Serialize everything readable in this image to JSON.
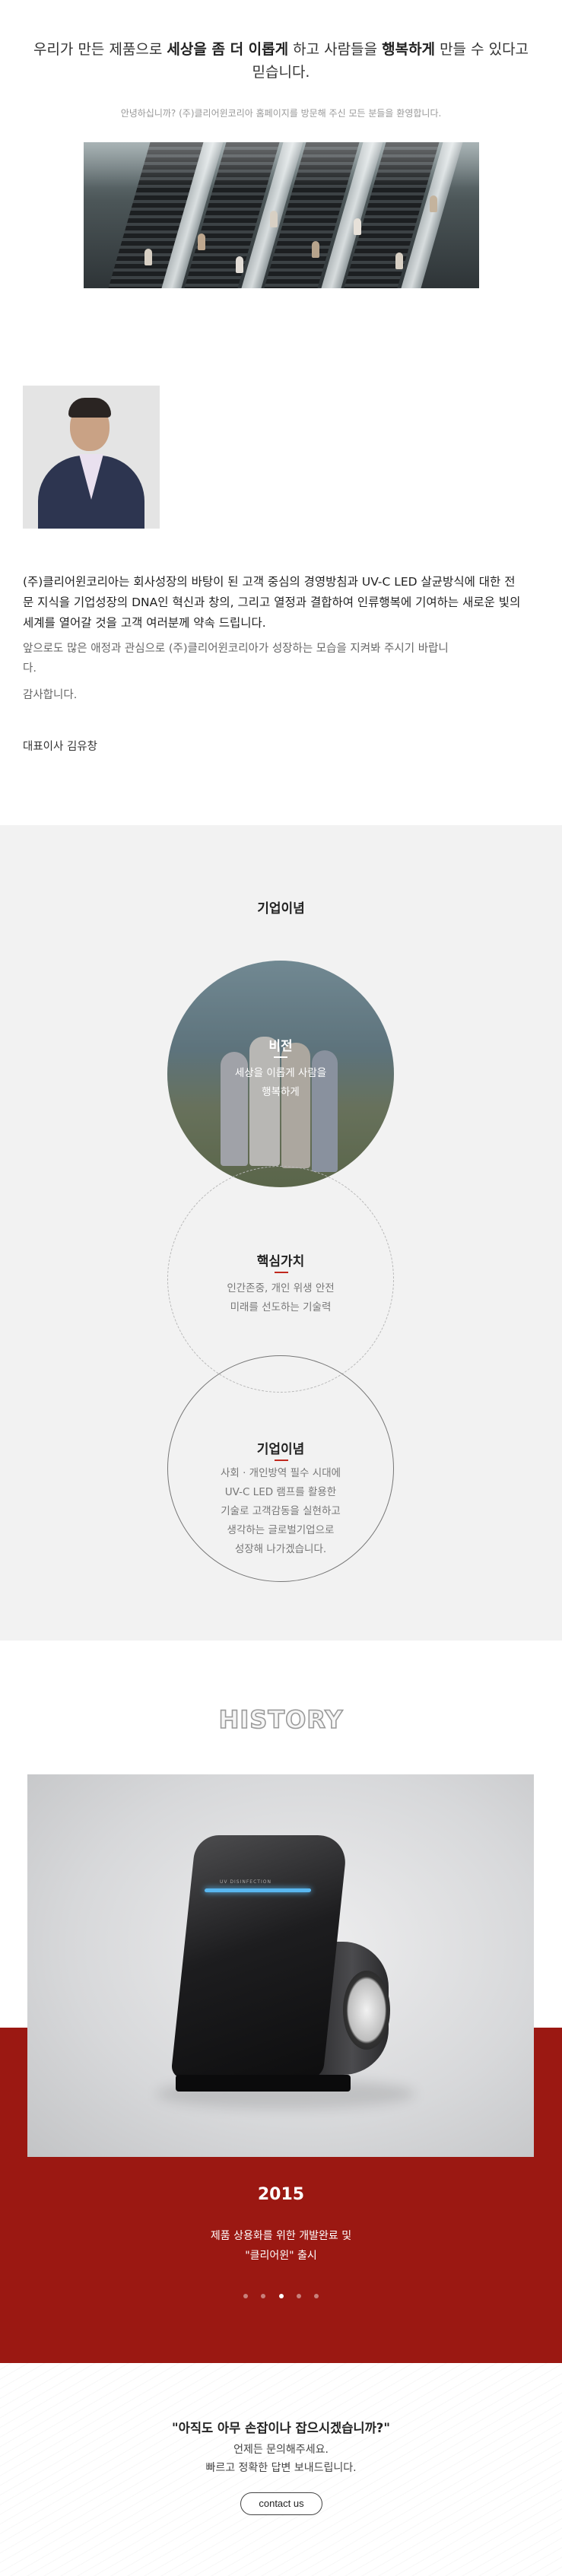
{
  "greeting": {
    "headline_parts": [
      "우리가 만든 제품으로 ",
      "세상을 좀 더 이롭게",
      " 하고 사람들을 ",
      "행복하게",
      " 만들 수 있다고 믿습니다."
    ],
    "welcome": "안녕하십니까? (주)클리어윈코리아 홈페이지를 방문해 주신 모든 분들을 환영합니다.",
    "intro": "(주)클리어윈코리아는 회사성장의 바탕이 된 고객 중심의 경영방침과 UV-C LED 살균방식에 대한 전문 지식을 기업성장의 DNA인 혁신과 창의, 그리고 열정과 결합하여 인류행복에 기여하는 새로운 빛의 세계를 열어갈 것을 고객 여러분께 약속 드립니다.",
    "support": "앞으로도 많은 애정과 관심으로 (주)클리어윈코리아가 성장하는 모습을 지켜봐 주시기 바랍니다.",
    "thanks": "감사합니다.",
    "signature": "대표이사 김유창"
  },
  "philosophy": {
    "title": "기업이념",
    "items": [
      {
        "title": "비전",
        "desc": [
          "세상을 이롭게 사람을",
          "행복하게"
        ]
      },
      {
        "title": "핵심가치",
        "desc": [
          "인간존중, 개인 위생 안전",
          "미래를 선도하는 기술력"
        ]
      },
      {
        "title": "기업이념",
        "desc": [
          "사회 · 개인방역 필수 시대에",
          "UV-C LED 램프를 활용한",
          "기술로 고객감동을 실현하고",
          "생각하는 글로벌기업으로",
          "성장해 나가겠습니다."
        ]
      }
    ]
  },
  "history": {
    "title": "HISTORY",
    "device_label": "UV DISINFECTION",
    "year": "2015",
    "desc": [
      "제품 상용화를 위한 개발완료 및",
      "\"클리어윈\" 출시"
    ],
    "slides": 5,
    "active_slide": 3
  },
  "contact": {
    "title": "\"아직도 아무 손잡이나 잡으시겠습니까?\"",
    "desc": [
      "언제든 문의해주세요.",
      "빠르고 정확한 답변 보내드립니다."
    ],
    "button_label": "contact us"
  },
  "colors": {
    "accent": "#9b1812",
    "bar": "#c0281e",
    "led": "#59b7f0"
  }
}
